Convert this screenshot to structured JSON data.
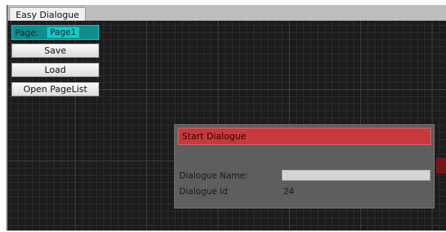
{
  "window": {
    "tab_title": "Easy Dialogue"
  },
  "toolbar": {
    "page_label": "Page:",
    "page_value": "Page1",
    "save_label": "Save",
    "load_label": "Load",
    "open_pagelist_label": "Open PageList"
  },
  "node": {
    "title": "Start Dialogue",
    "name_label": "Dialogue Name:",
    "name_value": "",
    "id_label": "Dialogue Id",
    "id_value": "24"
  },
  "colors": {
    "canvas_background": "#1c1c1c",
    "page_selector": "#0f8e8e",
    "node_header": "#c73a3a",
    "node_body": "#5e5e5e"
  }
}
